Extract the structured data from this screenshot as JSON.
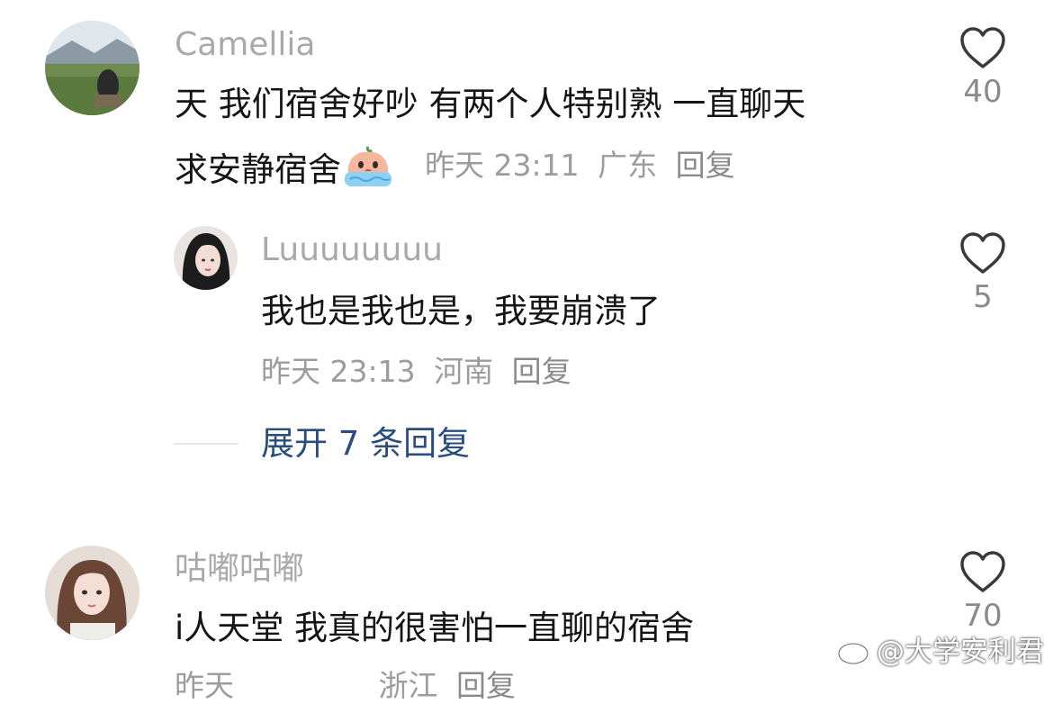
{
  "comments": [
    {
      "username": "Camellia",
      "text_line1": "天 我们宿舍好吵 有两个人特别熟 一直聊天",
      "text_line2": "求安静宿舍",
      "emoji": "crying-peach-emoji",
      "time": "昨天 23:11",
      "location": "广东",
      "reply_label": "回复",
      "likes": "40"
    },
    {
      "username": "Luuuuuuuu",
      "text_line1": "我也是我也是，我要崩溃了",
      "time": "昨天 23:13",
      "location": "河南",
      "reply_label": "回复",
      "likes": "5"
    },
    {
      "username": "咕嘟咕嘟",
      "text_line1": "i人天堂 我真的很害怕一直聊的宿舍",
      "time": "昨天",
      "location": "浙江",
      "reply_label": "回复",
      "likes": "70"
    }
  ],
  "expand_replies": "展开 7 条回复",
  "watermark": "@大学安利君",
  "icons": {
    "like": "heart-outline-icon",
    "watermark": "weibo-icon"
  },
  "colors": {
    "username": "#a9a9a9",
    "text": "#151515",
    "meta": "#9c9c9c",
    "expand": "#2b4d7d"
  }
}
